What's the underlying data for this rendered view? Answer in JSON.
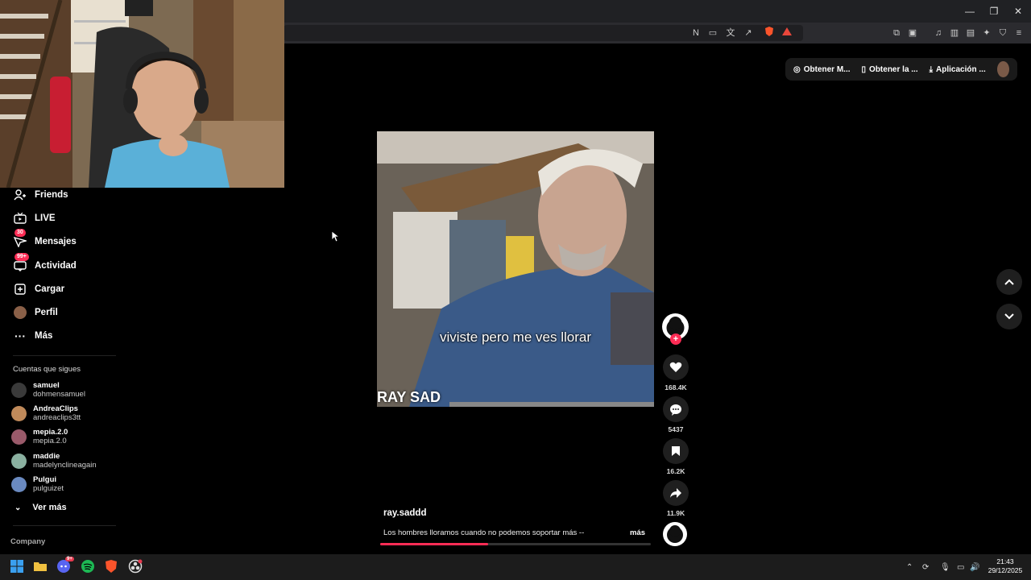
{
  "sidebar": {
    "items": [
      {
        "label": "Friends",
        "icon": "friends-icon"
      },
      {
        "label": "LIVE",
        "icon": "live-icon"
      },
      {
        "label": "Mensajes",
        "icon": "messages-icon",
        "badge": "30"
      },
      {
        "label": "Actividad",
        "icon": "activity-icon",
        "badge": "99+"
      },
      {
        "label": "Cargar",
        "icon": "upload-icon"
      },
      {
        "label": "Perfil",
        "icon": "avatar"
      },
      {
        "label": "Más",
        "icon": "more-icon"
      }
    ],
    "following_title": "Cuentas que sigues",
    "following": [
      {
        "name": "samuel",
        "handle": "dohmensamuel",
        "color": "#3a3a3a"
      },
      {
        "name": "AndreaClips",
        "handle": "andreaclips3tt",
        "color": "#c08a5a"
      },
      {
        "name": "mepia.2.0",
        "handle": "mepia.2.0",
        "color": "#9a5a6a"
      },
      {
        "name": "maddie",
        "handle": "madelynclineagain",
        "color": "#8ab0a0"
      },
      {
        "name": "Pulgui",
        "handle": "pulguizet",
        "color": "#6a8ac0"
      }
    ],
    "see_more": "Ver más",
    "company": "Company"
  },
  "topright": {
    "btn1": "Obtener M...",
    "btn2": "Obtener la ...",
    "btn3": "Aplicación ..."
  },
  "video": {
    "caption": "viviste pero me ves llorar",
    "watermark": "RAY SAD",
    "author": "ray.saddd",
    "description": "Los hombres lloramos cuando no podemos soportar más --",
    "more": "más",
    "progress": 0.4
  },
  "actions": {
    "likes": "168.4K",
    "comments": "5437",
    "saves": "16.2K",
    "shares": "11.9K"
  },
  "taskbar": {
    "time": "21:43",
    "date": "29/12/2025",
    "discord_badge": "9+"
  },
  "colors": {
    "accent": "#fe2c55",
    "background": "#000000"
  }
}
